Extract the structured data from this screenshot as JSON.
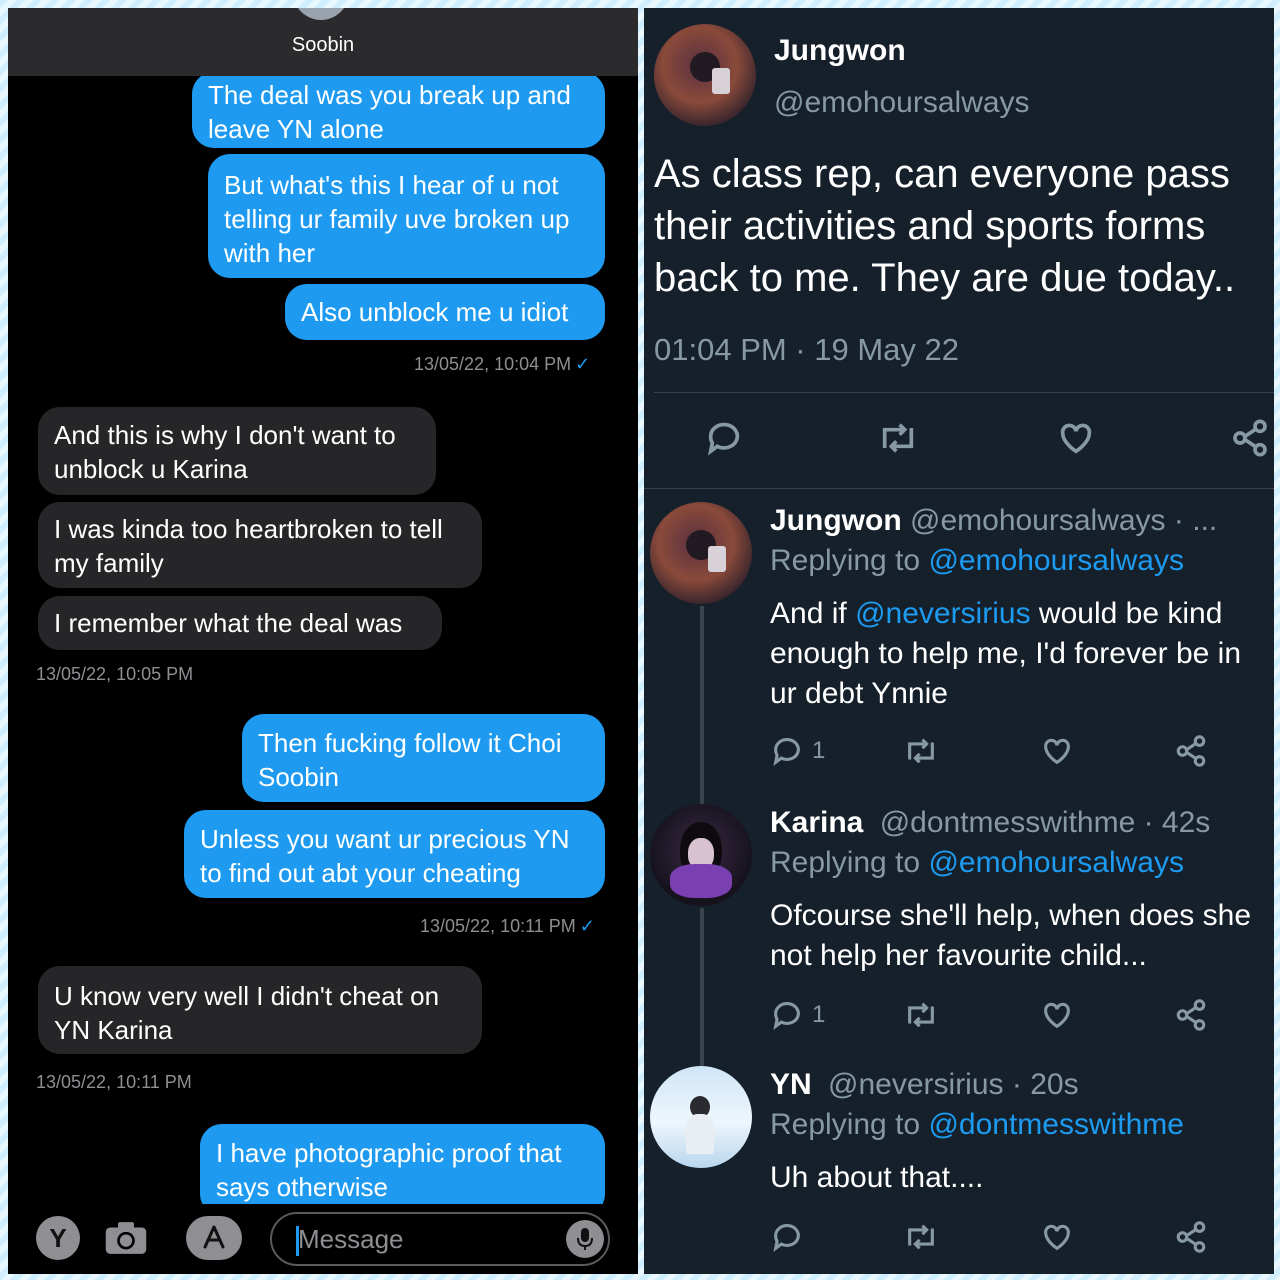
{
  "messages_app": {
    "contact_name": "Soobin",
    "bubbles": [
      {
        "text": "The deal was you break up and leave YN alone"
      },
      {
        "text": "But what's this I hear of u not telling ur family uve broken up with her"
      },
      {
        "text": "Also unblock me u idiot"
      },
      {
        "text": "And this is why I don't want to unblock u Karina"
      },
      {
        "text": "I was kinda too heartbroken to tell my family"
      },
      {
        "text": "I remember what the deal was"
      },
      {
        "text": "Then fucking follow it Choi Soobin"
      },
      {
        "text": "Unless you want ur precious YN to find out abt your cheating"
      },
      {
        "text": "U know very well I didn't cheat on YN Karina"
      },
      {
        "text": "I have photographic proof that says otherwise"
      }
    ],
    "timestamps": [
      "13/05/22, 10:04 PM",
      "13/05/22, 10:05 PM",
      "13/05/22, 10:11 PM",
      "13/05/22, 10:11 PM"
    ],
    "read_check": "✓",
    "composer": {
      "placeholder": "Message",
      "memoji_label": "Y",
      "camera_icon": "camera-icon",
      "appstore_icon": "appstore-icon",
      "mic_icon": "microphone-icon"
    }
  },
  "twitter": {
    "main_tweet": {
      "name": "Jungwon",
      "handle": "@emohoursalways",
      "text": "As class rep, can everyone pass their activities and sports forms back to me. They are due today..",
      "timestamp": "01:04 PM · 19 May 22"
    },
    "replies": [
      {
        "name": "Jungwon",
        "handle": "@emohoursalways",
        "meta": "· ...",
        "replying_prefix": "Replying to",
        "replying_to": "@emohoursalways",
        "text_before": "And if",
        "mention": "@neversirius",
        "text_after": "would be kind enough to help me, I'd forever be in ur debt Ynnie",
        "reply_count": "1"
      },
      {
        "name": "Karina",
        "handle": "@dontmesswithme",
        "meta": "· 42s",
        "replying_prefix": "Replying to",
        "replying_to": "@emohoursalways",
        "text": "Ofcourse she'll help, when does she not help her favourite child...",
        "reply_count": "1"
      },
      {
        "name": "YN",
        "handle": "@neversirius",
        "meta": "· 20s",
        "replying_prefix": "Replying to",
        "replying_to": "@dontmesswithme",
        "text": "Uh about that....",
        "reply_count": ""
      }
    ],
    "colors": {
      "background": "#15202b",
      "accent": "#1d9bf0",
      "muted": "#8899a6"
    }
  }
}
